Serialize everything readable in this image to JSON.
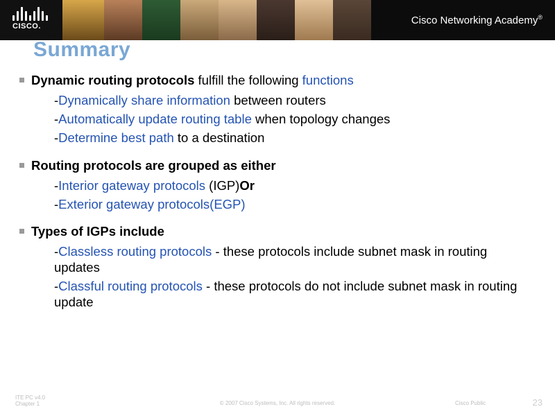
{
  "header": {
    "logo_text": "CISCO.",
    "academy_text": "Cisco Networking Academy",
    "trademark": "®"
  },
  "title": "Summary",
  "bullets": [
    {
      "lead_bold": "Dynamic routing protocols",
      "lead_plain": " fulfill the following ",
      "lead_blue": "functions",
      "subs": [
        {
          "dash": "-",
          "blue": "Dynamically share information",
          "plain": " between routers"
        },
        {
          "dash": "-",
          "blue": "Automatically update routing table",
          "plain": " when topology changes"
        },
        {
          "dash": "-",
          "blue": "Determine best path",
          "plain": " to a destination"
        }
      ]
    },
    {
      "lead_bold": "Routing protocols are grouped as either",
      "lead_plain": "",
      "lead_blue": "",
      "subs": [
        {
          "dash": "-",
          "blue": "Interior gateway protocols",
          "plain": " (IGP)",
          "trail_bold": "Or"
        },
        {
          "dash": "-",
          "blue": "Exterior gateway protocols(EGP)",
          "plain": ""
        }
      ]
    },
    {
      "lead_bold": "Types of IGPs include",
      "lead_plain": "",
      "lead_blue": "",
      "subs": [
        {
          "dash": "-",
          "blue": "Classless routing protocols",
          "plain": " - these protocols include subnet mask in routing updates"
        },
        {
          "dash": "-",
          "blue": "Classful routing protocols",
          "plain": " - these protocols do not include subnet mask in routing update"
        }
      ]
    }
  ],
  "footer": {
    "left_line1": "ITE PC v4.0",
    "left_line2": "Chapter 1",
    "center": "© 2007 Cisco Systems, Inc. All rights reserved.",
    "right1": "Cisco Public",
    "page": "23"
  }
}
